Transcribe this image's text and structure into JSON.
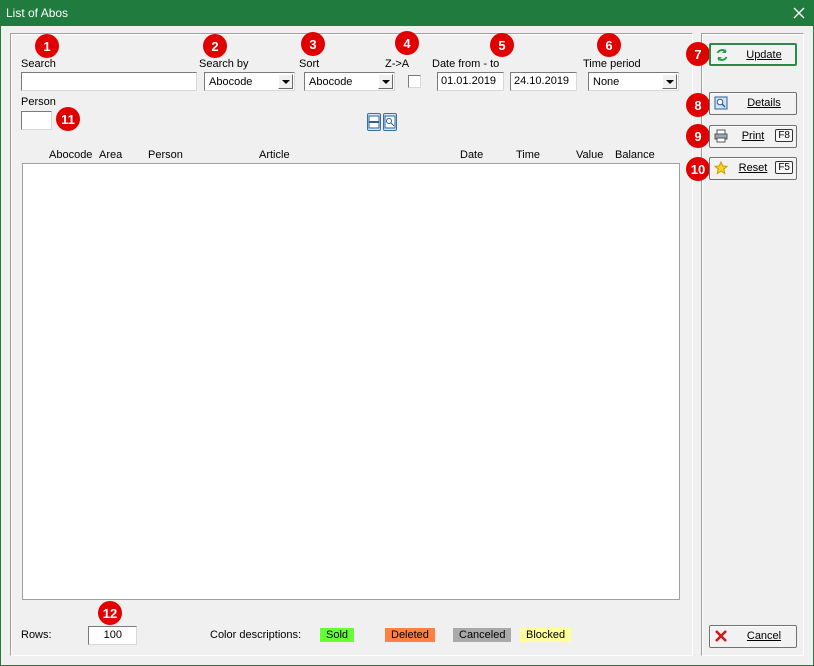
{
  "window": {
    "title": "List of Abos"
  },
  "filters": {
    "search_label": "Search",
    "search_value": "",
    "search_by_label": "Search by",
    "search_by_value": "Abocode",
    "sort_label": "Sort",
    "sort_value": "Abocode",
    "z_to_a_label": "Z->A",
    "date_label": "Date from - to",
    "date_from": "01.01.2019",
    "date_to": "24.10.2019",
    "time_period_label": "Time period",
    "time_period_value": "None",
    "person_label": "Person",
    "person_value": ""
  },
  "badges": [
    "1",
    "2",
    "3",
    "4",
    "5",
    "6",
    "7",
    "8",
    "9",
    "10",
    "11",
    "12"
  ],
  "table": {
    "columns": [
      "Abocode",
      "Area",
      "Person",
      "Article",
      "Date",
      "Time",
      "Value",
      "Balance"
    ],
    "rows": []
  },
  "buttons": {
    "update": "Update",
    "details": "Details",
    "print": "Print",
    "print_key": "F8",
    "reset": "Reset",
    "reset_key": "F5",
    "cancel": "Cancel"
  },
  "footer": {
    "rows_label": "Rows:",
    "rows_value": "100",
    "color_desc_label": "Color descriptions:",
    "legend": [
      {
        "label": "Sold",
        "color": "#66ff33"
      },
      {
        "label": "Deleted",
        "color": "#ff8040"
      },
      {
        "label": "Canceled",
        "color": "#a9a9a9"
      },
      {
        "label": "Blocked",
        "color": "#ffff99"
      }
    ]
  },
  "colors": {
    "titlebar": "#1f7c3e",
    "badge": "#e00000"
  }
}
